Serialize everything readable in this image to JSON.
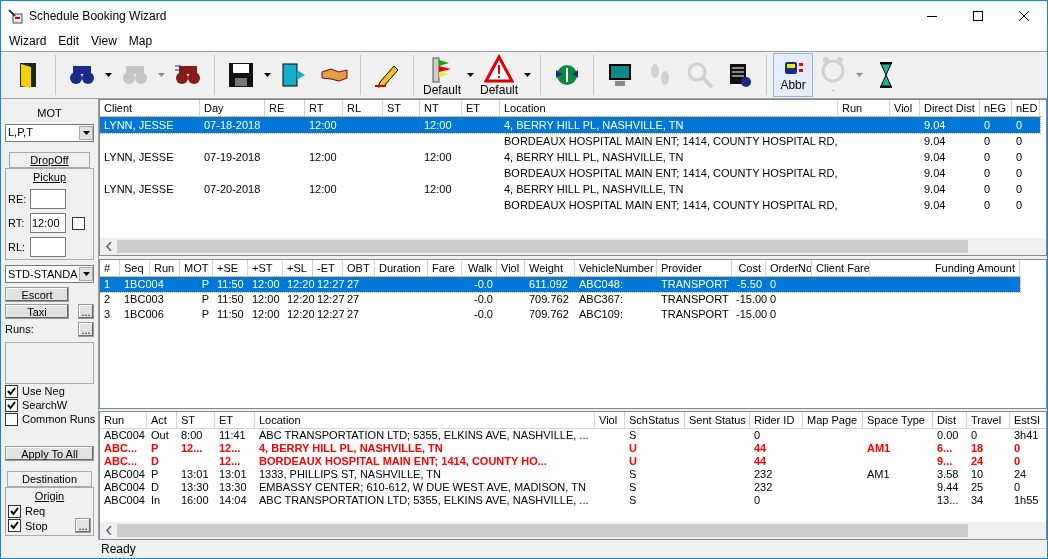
{
  "window": {
    "title": "Schedule Booking Wizard"
  },
  "menu": [
    "Wizard",
    "Edit",
    "View",
    "Map"
  ],
  "toolbar": [
    {
      "dropdown": false,
      "disabled": false,
      "pressed": false
    },
    {
      "dropdown": true,
      "disabled": false,
      "pressed": false
    },
    {
      "dropdown": true,
      "disabled": true,
      "pressed": false
    },
    {
      "dropdown": false,
      "disabled": false,
      "pressed": false
    },
    {
      "dropdown": true,
      "disabled": false,
      "pressed": false
    },
    {
      "dropdown": false,
      "disabled": false,
      "pressed": false
    },
    {
      "dropdown": false,
      "disabled": false,
      "pressed": false
    },
    {
      "dropdown": false,
      "disabled": false,
      "pressed": false
    },
    {
      "dropdown": true,
      "disabled": false,
      "pressed": false,
      "label": "Default"
    },
    {
      "dropdown": true,
      "disabled": false,
      "pressed": false,
      "label": "Default"
    },
    {
      "dropdown": false,
      "disabled": false,
      "pressed": false
    },
    {
      "dropdown": false,
      "disabled": false,
      "pressed": false
    },
    {
      "dropdown": false,
      "disabled": true,
      "pressed": false
    },
    {
      "dropdown": false,
      "disabled": true,
      "pressed": false
    },
    {
      "dropdown": false,
      "disabled": false,
      "pressed": false
    },
    {
      "dropdown": false,
      "disabled": false,
      "pressed": true,
      "label": "Abbr"
    },
    {
      "dropdown": true,
      "disabled": true,
      "pressed": false,
      "label": "-"
    },
    {
      "dropdown": false,
      "disabled": false,
      "pressed": false
    }
  ],
  "left": {
    "mot_label": "MOT",
    "mot_value": "L,P,T",
    "dropoff_tab": "DropOff",
    "pickup_tab": "Pickup",
    "re_label": "RE:",
    "rt_label": "RT:",
    "rt_value": "12:00",
    "rt_checked": false,
    "rl_label": "RL:",
    "space_value": "STD-STANDA",
    "escort": "Escort",
    "taxi": "Taxi",
    "taxi_more": "...",
    "runs_label": "Runs:",
    "runs_more": "...",
    "options": [
      {
        "label": "Use Neg",
        "checked": true
      },
      {
        "label": "SearchW",
        "checked": true
      },
      {
        "label": "Common Runs",
        "checked": false
      }
    ],
    "apply": "Apply To All",
    "destination_tab": "Destination",
    "origin_tab": "Origin",
    "origin_options": [
      {
        "label": "Req",
        "checked": true
      },
      {
        "label": "Stop",
        "checked": true
      }
    ],
    "stop_more": "..."
  },
  "trips": {
    "columns": [
      "Client",
      "Day",
      "RE",
      "RT",
      "RL",
      "ST",
      "NT",
      "ET",
      "Location",
      "Run",
      "Viol",
      "Direct Dist",
      "nEG",
      "nED"
    ],
    "rows": [
      {
        "selected": true,
        "cells": [
          "LYNN, JESSE",
          "07-18-2018",
          null,
          "12:00",
          null,
          null,
          "12:00",
          null,
          "4, BERRY HILL PL, NASHVILLE, TN",
          null,
          null,
          "9.04",
          "0",
          "0"
        ]
      },
      {
        "selected": false,
        "cells": [
          null,
          null,
          null,
          null,
          null,
          null,
          null,
          null,
          "BORDEAUX HOSPITAL MAIN ENT; 1414, COUNTY HOSPITAL RD,",
          null,
          null,
          "9.04",
          "0",
          "0"
        ]
      },
      {
        "selected": false,
        "cells": [
          "LYNN, JESSE",
          "07-19-2018",
          null,
          "12:00",
          null,
          null,
          "12:00",
          null,
          "4, BERRY HILL PL, NASHVILLE, TN",
          null,
          null,
          "9.04",
          "0",
          "0"
        ]
      },
      {
        "selected": false,
        "cells": [
          null,
          null,
          null,
          null,
          null,
          null,
          null,
          null,
          "BORDEAUX HOSPITAL MAIN ENT; 1414, COUNTY HOSPITAL RD,",
          null,
          null,
          "9.04",
          "0",
          "0"
        ]
      },
      {
        "selected": false,
        "cells": [
          "LYNN, JESSE",
          "07-20-2018",
          null,
          "12:00",
          null,
          null,
          "12:00",
          null,
          "4, BERRY HILL PL, NASHVILLE, TN",
          null,
          null,
          "9.04",
          "0",
          "0"
        ]
      },
      {
        "selected": false,
        "cells": [
          null,
          null,
          null,
          null,
          null,
          null,
          null,
          null,
          "BORDEAUX HOSPITAL MAIN ENT; 1414, COUNTY HOSPITAL RD,",
          null,
          null,
          "9.04",
          "0",
          "0"
        ]
      }
    ]
  },
  "runs": {
    "columns": [
      "#",
      "Seq",
      "Run",
      "MOT",
      "+SE",
      "+ST",
      "+SL",
      "-ET",
      "OBT",
      "Duration",
      "Fare",
      "Walk",
      "Viol",
      "Weight",
      "VehicleNumber",
      "Provider",
      "Cost",
      "OrderNo",
      "Client Fare",
      "Funding Amount"
    ],
    "rows": [
      {
        "selected": true,
        "cells": [
          "1",
          "1BC004",
          null,
          "P",
          "11:50",
          "12:00",
          "12:20",
          "12:27",
          "27",
          null,
          null,
          "-0.0",
          null,
          "611.092",
          "ABC048:",
          "TRANSPORT",
          "-5.50",
          "0",
          null,
          null
        ]
      },
      {
        "selected": false,
        "cells": [
          "2",
          "1BC003",
          null,
          "P",
          "11:50",
          "12:00",
          "12:20",
          "12:27",
          "27",
          null,
          null,
          "-0.0",
          null,
          "709.762",
          "ABC367:",
          "TRANSPORT",
          "-15.00",
          "0",
          null,
          null
        ]
      },
      {
        "selected": false,
        "cells": [
          "3",
          "1BC006",
          null,
          "P",
          "11:50",
          "12:00",
          "12:20",
          "12:27",
          "27",
          null,
          null,
          "-0.0",
          null,
          "709.762",
          "ABC109:",
          "TRANSPORT",
          "-15.00",
          "0",
          null,
          null
        ]
      }
    ]
  },
  "stops": {
    "columns": [
      "Run",
      "Act",
      "ST",
      "ET",
      "Location",
      "Viol",
      "SchStatus",
      "Sent Status",
      "Rider ID",
      "Map Page",
      "Space Type",
      "Dist",
      "Travel",
      "EstSl"
    ],
    "rows": [
      {
        "alert": false,
        "cells": [
          "ABC004",
          "Out",
          "8:00",
          "11:41",
          "ABC TRANSPORTATION LTD; 5355, ELKINS AVE, NASHVILLE, ...",
          null,
          "S",
          null,
          "0",
          null,
          null,
          "0.00",
          "0",
          "3h41"
        ]
      },
      {
        "alert": true,
        "cells": [
          "ABC...",
          "P",
          "12...",
          "12...",
          "4, BERRY HILL PL, NASHVILLE, TN",
          null,
          "U",
          null,
          "44",
          null,
          "AM1",
          "6...",
          "18",
          "0"
        ]
      },
      {
        "alert": true,
        "cells": [
          "ABC...",
          "D",
          null,
          "12...",
          "BORDEAUX HOSPITAL MAIN ENT; 1414, COUNTY HO...",
          null,
          "U",
          null,
          "44",
          null,
          null,
          "9...",
          "24",
          "0"
        ]
      },
      {
        "alert": false,
        "cells": [
          "ABC004",
          "P",
          "13:01",
          "13:01",
          "1333, PHILLIPS ST, NASHVILLE, TN",
          null,
          "S",
          null,
          "232",
          null,
          "AM1",
          "3.58",
          "10",
          "24"
        ]
      },
      {
        "alert": false,
        "cells": [
          "ABC004",
          "D",
          "13:30",
          "13:30",
          "EMBASSY CENTER; 610-612, W DUE WEST AVE, MADISON, TN",
          null,
          "S",
          null,
          "232",
          null,
          null,
          "9.44",
          "25",
          "0"
        ]
      },
      {
        "alert": false,
        "cells": [
          "ABC004",
          "In",
          "16:00",
          "14:04",
          "ABC TRANSPORTATION LTD; 5355, ELKINS AVE, NASHVILLE, ...",
          null,
          "S",
          null,
          "0",
          null,
          null,
          "13...",
          "34",
          "1h55"
        ]
      }
    ]
  },
  "status_bar": "Ready"
}
